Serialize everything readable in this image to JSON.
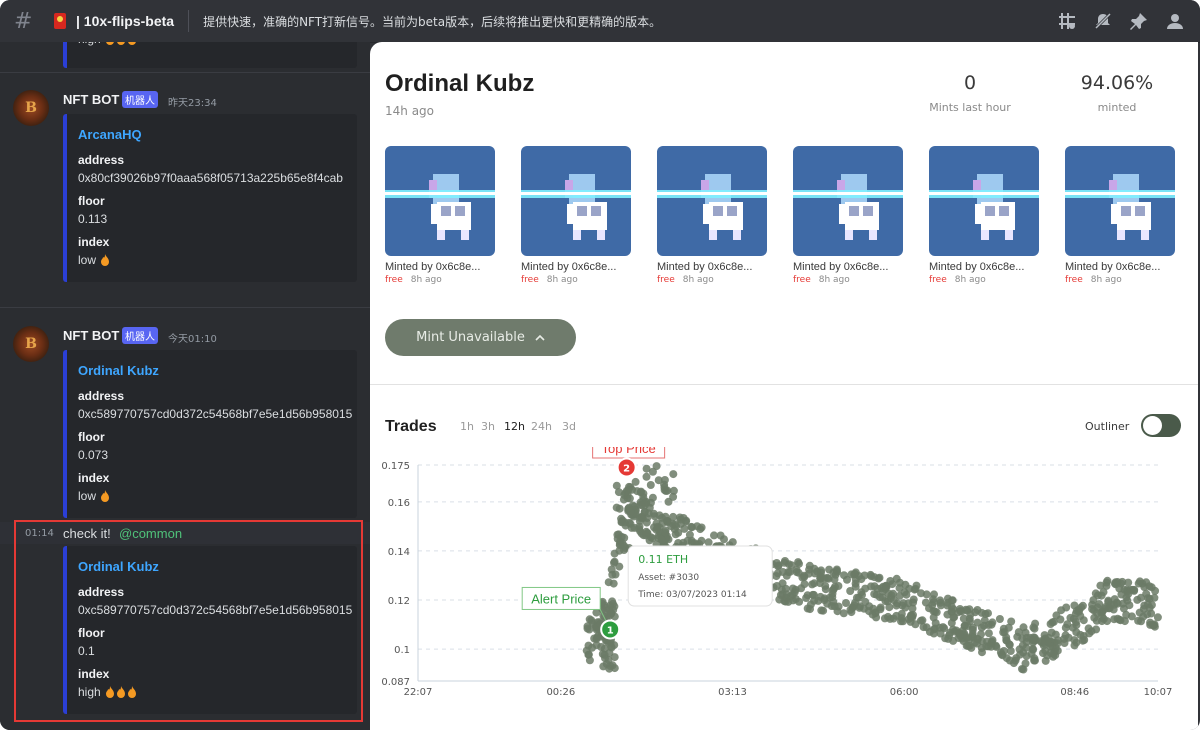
{
  "header": {
    "channel_name": "| 10x-flips-beta",
    "topic": "提供快速，准确的NFT打新信号。当前为beta版本，后续将推出更快和更精确的版本。",
    "icons": [
      "threads-icon",
      "mute-icon",
      "pin-icon",
      "members-icon"
    ]
  },
  "chat": {
    "top_partial": {
      "index_value": "high",
      "flames": 3
    },
    "messages": [
      {
        "author": "NFT BOT",
        "badge": "机器人",
        "timestamp": "昨天23:34",
        "embed": {
          "title": "ArcanaHQ",
          "address_label": "address",
          "address": "0x80cf39026b97f0aaa568f05713a225b65e8f4cab",
          "floor_label": "floor",
          "floor": "0.113",
          "index_label": "index",
          "index": "low",
          "flames": 1
        }
      },
      {
        "author": "NFT BOT",
        "badge": "机器人",
        "timestamp": "今天01:10",
        "embed": {
          "title": "Ordinal Kubz",
          "address_label": "address",
          "address": "0xc589770757cd0d372c54568bf7e5e1d56b958015",
          "floor_label": "floor",
          "floor": "0.073",
          "index_label": "index",
          "index": "low",
          "flames": 1
        }
      },
      {
        "timestamp": "01:14",
        "text": "check it!",
        "mention": "@common",
        "embed": {
          "title": "Ordinal Kubz",
          "address_label": "address",
          "address": "0xc589770757cd0d372c54568bf7e5e1d56b958015",
          "floor_label": "floor",
          "floor": "0.1",
          "index_label": "index",
          "index": "high",
          "flames": 3
        }
      }
    ]
  },
  "panel": {
    "title": "Ordinal Kubz",
    "subtitle": "14h ago",
    "stats": [
      {
        "value": "0",
        "label": "Mints last hour"
      },
      {
        "value": "94.06%",
        "label": "minted"
      }
    ],
    "nfts": [
      {
        "by": "Minted by 0x6c8e...",
        "price": "free",
        "ago": "8h ago"
      },
      {
        "by": "Minted by 0x6c8e...",
        "price": "free",
        "ago": "8h ago"
      },
      {
        "by": "Minted by 0x6c8e...",
        "price": "free",
        "ago": "8h ago"
      },
      {
        "by": "Minted by 0x6c8e...",
        "price": "free",
        "ago": "8h ago"
      },
      {
        "by": "Minted by 0x6c8e...",
        "price": "free",
        "ago": "8h ago"
      },
      {
        "by": "Minted by 0x6c8e...",
        "price": "free",
        "ago": "8h ago"
      }
    ],
    "mint_button": "Mint Unavailable",
    "trades_title": "Trades",
    "ranges": [
      "1h",
      "3h",
      "12h",
      "24h",
      "3d"
    ],
    "active_range": "12h",
    "outliner_label": "Outliner",
    "outliner_on": false
  },
  "colors": {
    "discord_bg": "#313338",
    "embed_bar": "#2b3fd6",
    "link_blue": "#3ea6ff",
    "dot_green": "#6b7a66",
    "alert_green": "#2e9d3f",
    "top_red": "#e53935",
    "highlight_red": "#e53935"
  },
  "chart_data": {
    "type": "scatter",
    "title": "",
    "xlabel": "",
    "ylabel": "",
    "x_ticks": [
      "22:07",
      "00:26",
      "03:13",
      "06:00",
      "08:46",
      "10:07"
    ],
    "y_ticks": [
      "0.087",
      "0.1",
      "0.12",
      "0.14",
      "0.16",
      "0.175"
    ],
    "ylim": [
      0.087,
      0.175
    ],
    "grid": "horizontal dashed",
    "annotations": {
      "top_price": {
        "label": "Top Price",
        "marker": "2",
        "x": "01:30",
        "y": 0.174
      },
      "alert_price": {
        "label": "Alert Price",
        "marker": "1",
        "x": "01:14",
        "y": 0.108
      },
      "tooltip": {
        "price": "0.11 ETH",
        "asset": "Asset: #3030",
        "time": "Time: 03/07/2023 01:14"
      }
    },
    "trend_segments": [
      {
        "x": "00:50",
        "y": 0.1
      },
      {
        "x": "01:14",
        "y": 0.12
      },
      {
        "x": "01:30",
        "y": 0.16
      },
      {
        "x": "02:00",
        "y": 0.15
      },
      {
        "x": "03:13",
        "y": 0.135
      },
      {
        "x": "04:30",
        "y": 0.125
      },
      {
        "x": "06:00",
        "y": 0.12
      },
      {
        "x": "07:00",
        "y": 0.11
      },
      {
        "x": "08:00",
        "y": 0.1
      },
      {
        "x": "08:46",
        "y": 0.11
      },
      {
        "x": "09:20",
        "y": 0.12
      },
      {
        "x": "10:07",
        "y": 0.118
      }
    ]
  }
}
